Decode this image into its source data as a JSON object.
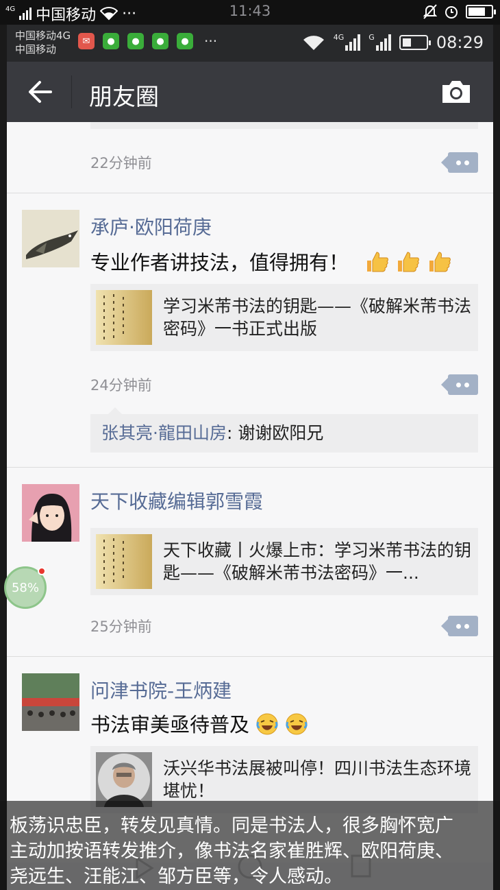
{
  "outer_status": {
    "signal_label": "4G",
    "carrier": "中国移动",
    "time": "11:43"
  },
  "inner_status": {
    "carrier_line1": "中国移动4G",
    "carrier_line2": "中国移动",
    "app_icons": [
      "mail-icon",
      "wechat-icon",
      "wechat-icon",
      "wechat-icon",
      "wechat-icon"
    ],
    "more": "···",
    "net1": "4G",
    "net2": "G",
    "time": "08:29"
  },
  "navbar": {
    "title": "朋友圈"
  },
  "feed": {
    "previous": {
      "time": "22分钟前"
    },
    "posts": [
      {
        "name": "承庐·欧阳荷庚",
        "text": "专业作者讲技法，值得拥有！",
        "link_title": "学习米芾书法的钥匙——《破解米芾书法密码》一书正式出版",
        "time": "24分钟前",
        "reply_user": "张其亮·龍田山房",
        "reply_text": ": 谢谢欧阳兄"
      },
      {
        "name": "天下收藏编辑郭雪霞",
        "link_title": "天下收藏丨火爆上市：学习米芾书法的钥匙——《破解米芾书法密码》一...",
        "time": "25分钟前"
      },
      {
        "name": "问津书院-王炳建",
        "text": "书法审美亟待普及",
        "link_title": "沃兴华书法展被叫停！四川书法生态环境堪忧！"
      }
    ]
  },
  "float_ball": {
    "percent": "58%"
  },
  "caption": {
    "line1": "板荡识忠臣，转发见真情。同是书法人，很多胸怀宽广",
    "line2": "主动加按语转发推介，像书法名家崔胜辉、欧阳荷庚、",
    "line3": "尧远生、汪能江、邹方臣等，令人感动。"
  }
}
